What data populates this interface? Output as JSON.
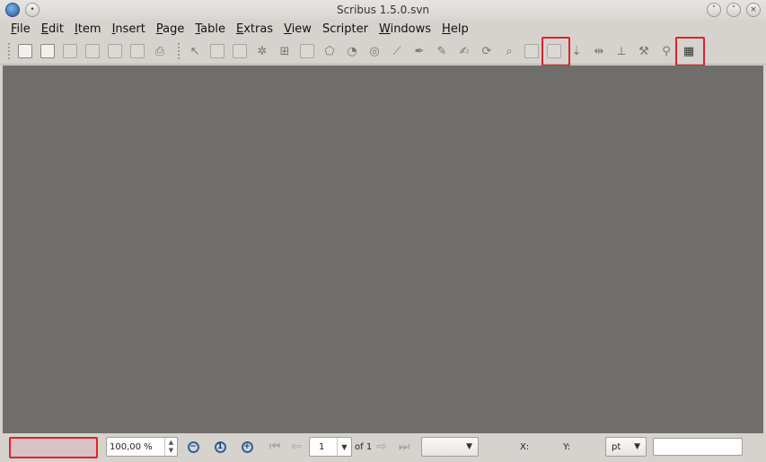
{
  "window": {
    "title": "Scribus 1.5.0.svn"
  },
  "menubar": {
    "items": [
      {
        "label": "File",
        "accel": "F",
        "rest": "ile"
      },
      {
        "label": "Edit",
        "accel": "E",
        "rest": "dit"
      },
      {
        "label": "Item",
        "accel": "I",
        "rest": "tem"
      },
      {
        "label": "Insert",
        "accel": "I",
        "rest": "nsert"
      },
      {
        "label": "Page",
        "accel": "P",
        "rest": "age"
      },
      {
        "label": "Table",
        "accel": "T",
        "rest": "able"
      },
      {
        "label": "Extras",
        "accel": "E",
        "rest": "xtras"
      },
      {
        "label": "View",
        "accel": "V",
        "rest": "iew"
      },
      {
        "label": "Scripter",
        "accel": "",
        "rest": "Scripter"
      },
      {
        "label": "Windows",
        "accel": "W",
        "rest": "indows"
      },
      {
        "label": "Help",
        "accel": "H",
        "rest": "elp"
      }
    ]
  },
  "toolbar": {
    "icons": [
      "new-document-icon",
      "open-document-icon",
      "save-document-icon",
      "close-document-icon",
      "print-icon",
      "preflight-icon",
      "export-pdf-icon",
      "select-tool-icon",
      "text-frame-icon",
      "image-frame-icon",
      "render-frame-icon",
      "table-icon",
      "shape-icon",
      "polygon-icon",
      "arc-icon",
      "spiral-icon",
      "line-icon",
      "bezier-icon",
      "freehand-icon",
      "calligraphic-icon",
      "rotate-icon",
      "zoom-tool-icon",
      "edit-text-icon",
      "story-editor-icon",
      "link-frames-icon",
      "unlink-frames-icon",
      "measure-icon",
      "copy-properties-icon",
      "eyedropper-icon",
      "barcode-generator-icon"
    ],
    "highlighted": [
      "story-editor-icon",
      "barcode-generator-icon"
    ]
  },
  "statusbar": {
    "message": "",
    "zoom_value": "100,00 %",
    "page_number": "1",
    "page_of": "of 1",
    "layer_select": "",
    "x_label": "X:",
    "y_label": "Y:",
    "unit": "pt",
    "field_value": ""
  },
  "colors": {
    "highlight": "#e0202a",
    "canvas": "#6f6e6b",
    "window_bg": "#d6d3cf"
  }
}
